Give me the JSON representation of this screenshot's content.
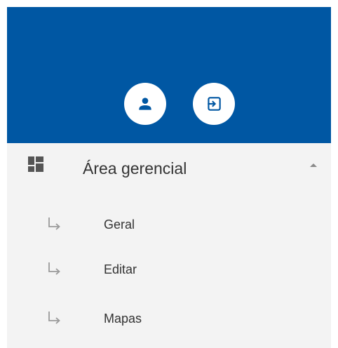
{
  "colors": {
    "header_bg": "#0057a3",
    "menu_bg": "#f3f3f3",
    "text": "#333333",
    "icon_gray": "#9a9a9a"
  },
  "header": {
    "buttons": [
      {
        "icon": "person-icon"
      },
      {
        "icon": "logout-icon"
      }
    ]
  },
  "menu": {
    "title": "Área gerencial",
    "icon": "dashboard-icon",
    "expanded": true,
    "items": [
      {
        "label": "Geral",
        "icon": "subdirectory-arrow-right-icon"
      },
      {
        "label": "Editar",
        "icon": "subdirectory-arrow-right-icon"
      },
      {
        "label": "Mapas",
        "icon": "subdirectory-arrow-right-icon"
      }
    ]
  }
}
